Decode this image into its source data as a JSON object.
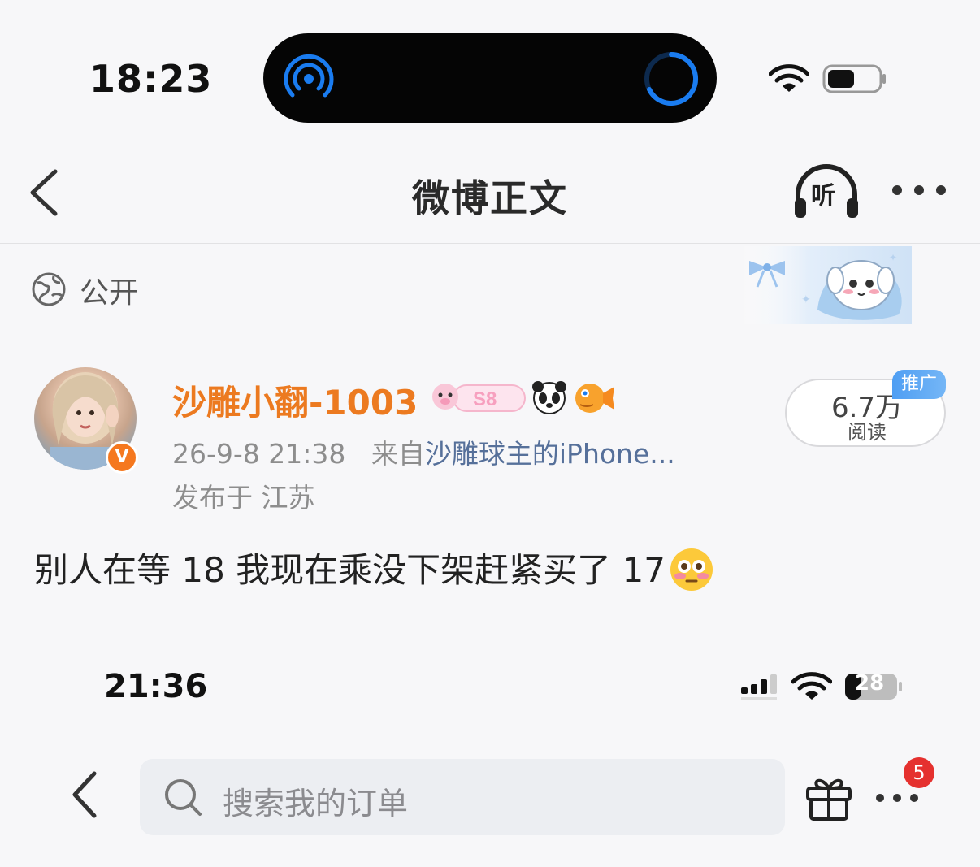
{
  "status_bar_top": {
    "time": "18:23"
  },
  "nav": {
    "title": "微博正文",
    "listen_label": "听"
  },
  "visibility": {
    "label": "公开"
  },
  "post": {
    "username": "沙雕小翻-1003",
    "verify_badge": "V",
    "date": "26-9-8 21:38",
    "source_prefix": "来自",
    "source": "沙雕球主的iPhone...",
    "location": "发布于 江苏",
    "reads_count": "6.7万",
    "reads_label": "阅读",
    "promo_tag": "推广",
    "text": "别人在等 18 我现在乘没下架赶紧买了 17",
    "emoji": "flushed-face"
  },
  "embedded": {
    "time": "21:36",
    "battery": "28",
    "search_placeholder": "搜索我的订单",
    "notification_count": "5"
  },
  "colors": {
    "username": "#ec7a20",
    "source_link": "#56709a",
    "promo": "#4f9ef3",
    "badge": "#e5312f",
    "island_accent": "#1a7cf0"
  }
}
